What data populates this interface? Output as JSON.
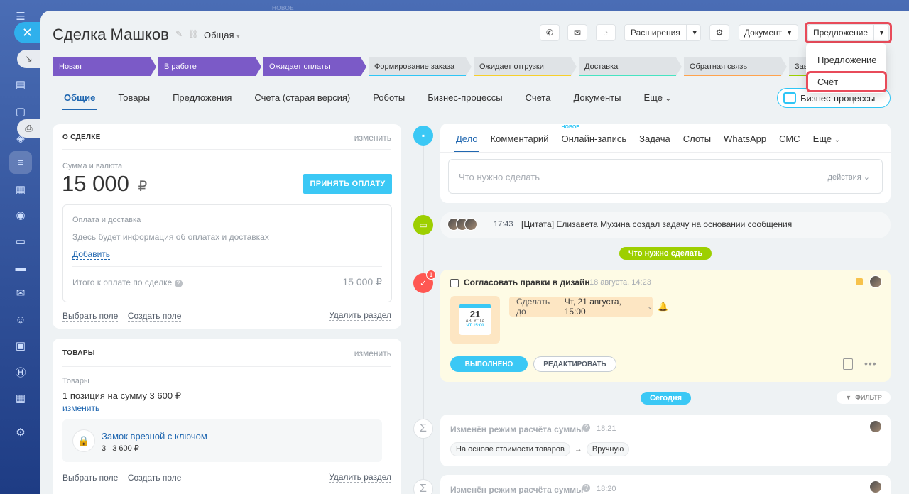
{
  "header": {
    "title": "Сделка Машков",
    "category": "Общая",
    "extensions_label": "Расширения",
    "document_label": "Документ",
    "proposal_label": "Предложение",
    "faded_badge": "НОВОЕ"
  },
  "dropdown": {
    "items": [
      "Предложение",
      "Счёт"
    ]
  },
  "stages": [
    {
      "label": "Новая",
      "done": true,
      "color": "#7b5ac7"
    },
    {
      "label": "В работе",
      "done": true,
      "color": "#7b5ac7"
    },
    {
      "label": "Ожидает оплаты",
      "done": true,
      "color": "#7b5ac7"
    },
    {
      "label": "Формирование заказа",
      "done": false,
      "color": "#2fc6f6"
    },
    {
      "label": "Ожидает отгрузки",
      "done": false,
      "color": "#f7d02a"
    },
    {
      "label": "Доставка",
      "done": false,
      "color": "#47e4c2"
    },
    {
      "label": "Обратная связь",
      "done": false,
      "color": "#ffa34d"
    },
    {
      "label": "Зав",
      "done": false,
      "color": "#9dcf00"
    }
  ],
  "tabs": [
    "Общие",
    "Товары",
    "Предложения",
    "Счета (старая версия)",
    "Роботы",
    "Бизнес-процессы",
    "Счета",
    "Документы",
    "Еще"
  ],
  "bp_button_label": "Бизнес-процессы",
  "about": {
    "header": "О СДЕЛКЕ",
    "edit": "изменить",
    "sum_label": "Сумма и валюта",
    "sum_value": "15 000",
    "currency": "₽",
    "accept_payment": "ПРИНЯТЬ ОПЛАТУ",
    "payment_title": "Оплата и доставка",
    "payment_info": "Здесь будет информация об оплатах и доставках",
    "add_link": "Добавить",
    "total_label": "Итого к оплате по сделке",
    "total_value": "15 000 ₽",
    "select_field": "Выбрать поле",
    "create_field": "Создать поле",
    "delete_section": "Удалить раздел"
  },
  "products": {
    "header": "ТОВАРЫ",
    "edit": "изменить",
    "label": "Товары",
    "summary": "1 позиция на сумму 3 600 ₽",
    "change": "изменить",
    "item_name": "Замок врезной с ключом",
    "item_qty": "3",
    "item_price": "3 600 ₽",
    "select_field": "Выбрать поле",
    "create_field": "Создать поле",
    "delete_section": "Удалить раздел"
  },
  "editor": {
    "tabs": [
      "Дело",
      "Комментарий",
      "Онлайн-запись",
      "Задача",
      "Слоты",
      "WhatsApp",
      "СМС",
      "Еще"
    ],
    "new_badge": "НОВОЕ",
    "placeholder": "Что нужно сделать",
    "actions": "действия"
  },
  "feed": {
    "message_time": "17:43",
    "message_text": "[Цитата] Елизавета Мухина создал задачу на основании сообщения",
    "todo_pill": "Что нужно сделать",
    "task_badge": "1",
    "task_title": "Согласовать правки в дизайн",
    "task_date": "18 августа, 14:23",
    "cal_day": "21",
    "cal_month": "АВГУСТА",
    "cal_time": "ЧТ 15:00",
    "deadline_prefix": "Сделать до",
    "deadline_value": "Чт, 21 августа, 15:00",
    "done_btn": "ВЫПОЛНЕНО",
    "edit_btn": "РЕДАКТИРОВАТЬ",
    "today_pill": "Сегодня",
    "filter_label": "ФИЛЬТР",
    "change1_title": "Изменён режим расчёта суммы",
    "change1_time": "18:21",
    "chip_from": "На основе стоимости товаров",
    "chip_to": "Вручную",
    "change2_title": "Изменён режим расчёта суммы",
    "change2_time": "18:20"
  }
}
